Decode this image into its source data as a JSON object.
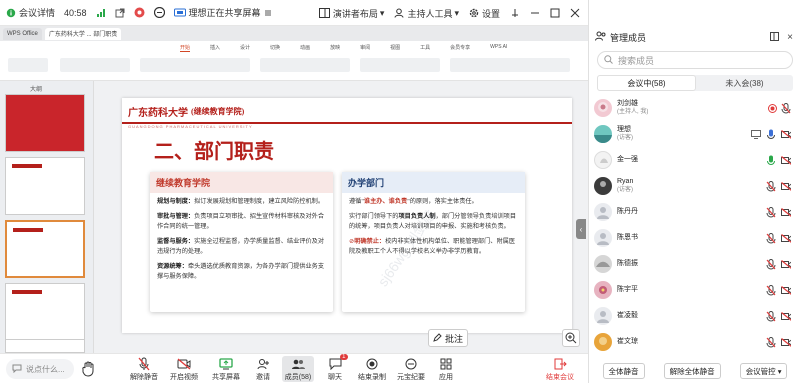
{
  "topbar": {
    "meeting_detail": "会议详情",
    "time": "40:58",
    "sharing_text": "理想正在共享屏幕",
    "presenter_layout": "演讲者布局",
    "host_tools": "主持人工具",
    "settings": "设置"
  },
  "share": {
    "tabs": [
      "WPS Office",
      "广东药科大学 ... 部门职责"
    ],
    "ribbon_menu": [
      "开始",
      "插入",
      "设计",
      "切换",
      "动画",
      "放映",
      "审阅",
      "视图",
      "工具",
      "会员专享",
      "WPS AI"
    ],
    "active_menu": "开始",
    "zoom_label": "大纲",
    "slide": {
      "university": "广东药科大学",
      "college": "(继续教育学院)",
      "subtitle": "GUANGDONG PHARMACEUTICAL UNIVERSITY",
      "title": "二、部门职责",
      "card1": {
        "heading": "继续教育学院",
        "p1_bold": "规划与制度：",
        "p1": "拟订发展规划和管理制度，建立风险防控机制。",
        "p2_bold": "审批与管理：",
        "p2": "负责项目立项审批、招生宣传材料审核及对外合作合同的统一管理。",
        "p3_bold": "监督与服务：",
        "p3": "实施全过程监督，办学质量监督、结业评价及对违规行为的处理。",
        "p4_bold": "资源统筹：",
        "p4": "牵头遴选优质教育资源，为各办学部门提供业务支撑与服务保障。"
      },
      "card2": {
        "heading": "办学部门",
        "p1_pre": "遵循\"",
        "p1_bold": "谁主办、谁负责",
        "p1_post": "\"的原则，落实主体责任。",
        "p2_pre": "实行部门领导下的",
        "p2_bold": "项目负责人制",
        "p2_post": "，部门分管领导负责培训项目的统筹，项目负责人对培训项目的申报、实施和考核负责。",
        "p3_bold": "明确禁止：",
        "p3": "校内非实体性机构单位、职能管理部门、附属医院及教职工个人不得以学校名义举办非学历教育。"
      }
    },
    "note_button": "批注",
    "watermark": "sj66wg 刘剑雄"
  },
  "bottombar": {
    "say_placeholder": "说点什么...",
    "buttons": [
      {
        "name": "unmute-button",
        "label": "解除静音"
      },
      {
        "name": "video-button",
        "label": "开启视频"
      },
      {
        "name": "share-screen-button",
        "label": "共享屏幕"
      },
      {
        "name": "invite-button",
        "label": "邀请"
      },
      {
        "name": "members-button",
        "label": "成员(58)"
      },
      {
        "name": "chat-button",
        "label": "聊天",
        "badge": "1"
      },
      {
        "name": "record-button",
        "label": "结束录制"
      },
      {
        "name": "meta-button",
        "label": "元宝纪要"
      },
      {
        "name": "apps-button",
        "label": "应用"
      }
    ],
    "end_label": "结束会议"
  },
  "panel": {
    "title": "管理成员",
    "search_placeholder": "搜索成员",
    "tab_in_meeting": "会议中(58)",
    "tab_not_joined": "未入会(38)",
    "members": [
      {
        "name": "刘剑雄",
        "sub": "(主持人, 我)",
        "avatar": "photo-pink"
      },
      {
        "name": "理想",
        "sub": "(访客)",
        "avatar": "photo-teal"
      },
      {
        "name": "金一强",
        "sub": "",
        "avatar": "photo-white"
      },
      {
        "name": "Ryan",
        "sub": "(访客)",
        "avatar": "photo-dark"
      },
      {
        "name": "陈丹丹",
        "sub": "",
        "avatar": "default"
      },
      {
        "name": "陈恩书",
        "sub": "",
        "avatar": "default"
      },
      {
        "name": "陈德振",
        "sub": "",
        "avatar": "photo-gray"
      },
      {
        "name": "陈宇平",
        "sub": "",
        "avatar": "photo-flower"
      },
      {
        "name": "崔凌毅",
        "sub": "",
        "avatar": "default"
      },
      {
        "name": "崔文琼",
        "sub": "",
        "avatar": "photo-orange"
      }
    ],
    "mute_all": "全体静音",
    "unmute_all": "解除全体静音",
    "meeting_control": "会议管控"
  }
}
